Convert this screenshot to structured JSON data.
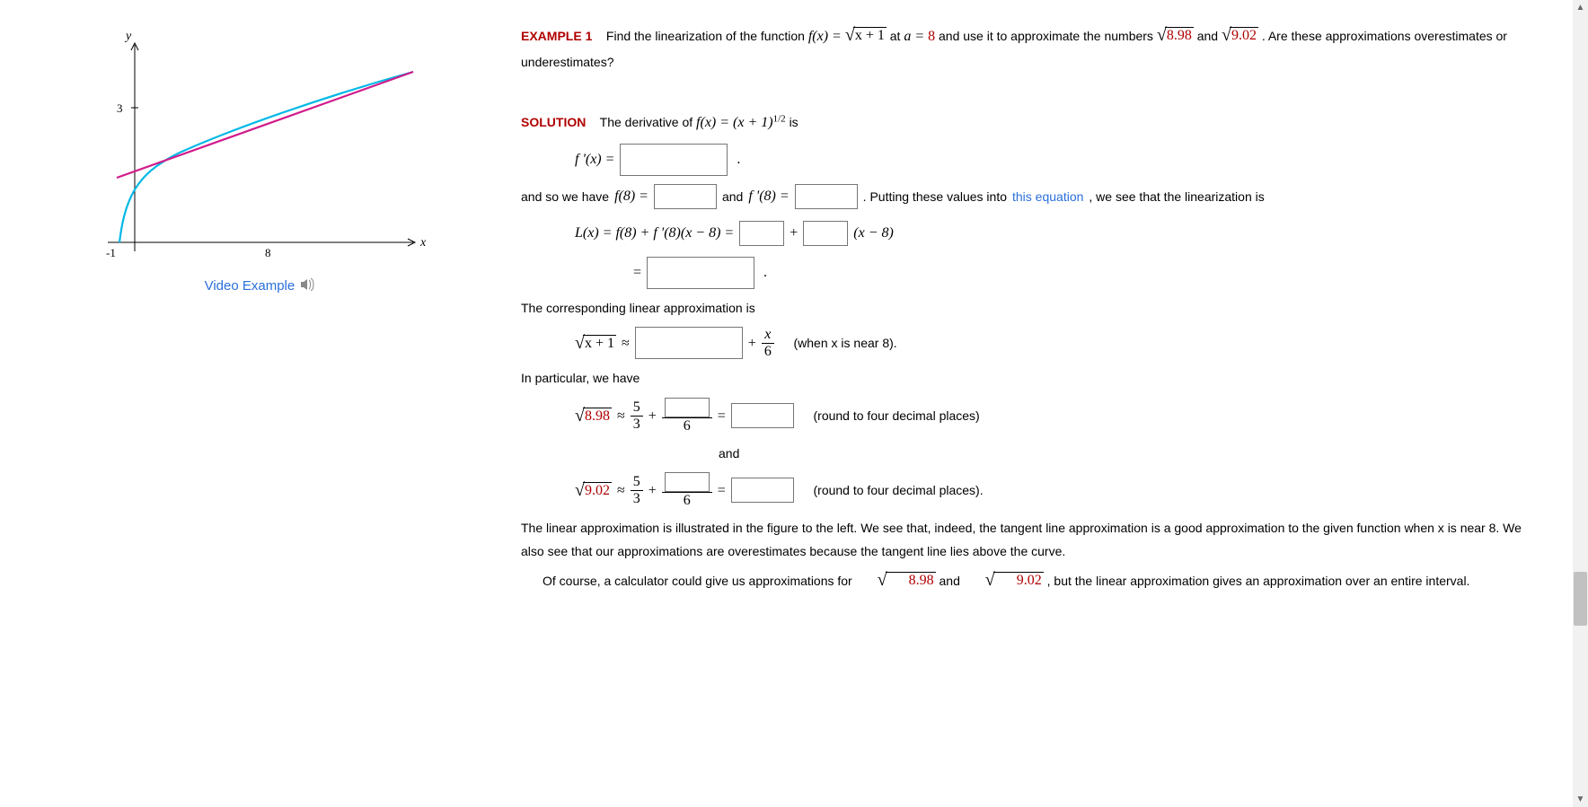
{
  "graph": {
    "y_label": "y",
    "x_label": "x",
    "x_ticks": [
      "-1",
      "8"
    ],
    "y_ticks": [
      "3"
    ]
  },
  "video_link": "Video Example",
  "example": {
    "label": "EXAMPLE 1",
    "intro_parts": {
      "t1": "Find the linearization of the function ",
      "fx_eq": "f(x) = ",
      "sqrt_arg_1": "x + 1",
      "t2": " at ",
      "a_eq": "a = ",
      "a_val": "8",
      "t3": " and use it to approximate the numbers ",
      "sqrt_arg_2": "8.98",
      "t4": " and ",
      "sqrt_arg_3": "9.02",
      "t5": ". Are these approximations overestimates or underestimates?"
    }
  },
  "solution": {
    "label": "SOLUTION",
    "deriv_line": {
      "t1": "The derivative of ",
      "fx": "f(x) = (x + 1)",
      "exp": "1/2",
      "t2": " is"
    },
    "fprime_eq": "f '(x) = ",
    "line2": {
      "t1": "and so we have ",
      "f8": "f(8) = ",
      "t2": " and ",
      "fp8": "f '(8) = ",
      "t3": ". Putting these values into ",
      "link": "this equation",
      "t4": ", we see that the linearization is"
    },
    "lx_line": {
      "lhs": "L(x) = f(8) + f '(8)(x − 8) = ",
      "plus": " + ",
      "tail": " (x − 8)"
    },
    "eq2_prefix": "= ",
    "corr_text": "The corresponding linear approximation is",
    "approx_line": {
      "sqrt_arg": "x + 1",
      "approx": " ≈ ",
      "plus": " + ",
      "frac_num": "x",
      "frac_den": "6",
      "when": "(when x is near 8)."
    },
    "in_particular": "In particular, we have",
    "calc1": {
      "sqrt_arg": "8.98",
      "approx": " ≈ ",
      "frac_a_num": "5",
      "frac_a_den": "3",
      "plus": " + ",
      "frac_b_den": "6",
      "eq": " = ",
      "note": "(round to four decimal places)"
    },
    "and_word": "and",
    "calc2": {
      "sqrt_arg": "9.02",
      "approx": " ≈ ",
      "frac_a_num": "5",
      "frac_a_den": "3",
      "plus": " + ",
      "frac_b_den": "6",
      "eq": " = ",
      "note": "(round to four decimal places)."
    },
    "closing1": "The linear approximation is illustrated in the figure to the left. We see that, indeed, the tangent line approximation is a good approximation to the given function when x is near 8. We also see that our approximations are overestimates because the tangent line lies above the curve.",
    "closing2_a": "Of course, a calculator could give us approximations for ",
    "closing2_sqrt1": "8.98",
    "closing2_b": " and ",
    "closing2_sqrt2": "9.02",
    "closing2_c": ", but the linear approximation gives an approximation over an entire interval."
  },
  "chart_data": {
    "type": "line",
    "title": "",
    "xlabel": "x",
    "ylabel": "y",
    "x_range": [
      -1,
      13
    ],
    "y_range": [
      0,
      4
    ],
    "series": [
      {
        "name": "f(x)=sqrt(x+1)",
        "color": "#00b8e6",
        "x": [
          -1,
          0,
          1,
          2,
          3,
          4,
          5,
          6,
          7,
          8,
          9,
          10,
          11,
          12,
          13
        ],
        "y": [
          0,
          1,
          1.41,
          1.73,
          2,
          2.24,
          2.45,
          2.65,
          2.83,
          3,
          3.16,
          3.32,
          3.46,
          3.61,
          3.74
        ]
      },
      {
        "name": "L(x)=5/3+x/6 (tangent at a=8)",
        "color": "#d11a8a",
        "x": [
          -1,
          13
        ],
        "y": [
          1.5,
          3.83
        ]
      }
    ],
    "x_ticks": [
      -1,
      8
    ],
    "y_ticks": [
      3
    ]
  }
}
